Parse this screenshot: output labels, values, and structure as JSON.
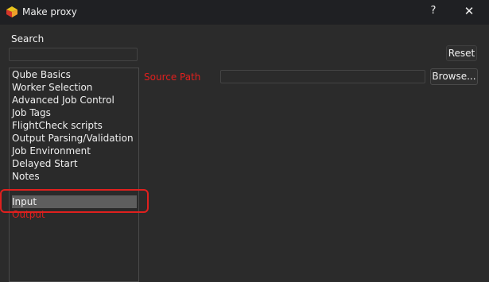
{
  "window": {
    "title": "Make proxy",
    "help_label": "?",
    "close_label": "✕",
    "app_icon": "qube-logo-icon"
  },
  "search": {
    "label": "Search",
    "value": "",
    "placeholder": ""
  },
  "reset_label": "Reset",
  "categories": [
    {
      "label": "Qube Basics"
    },
    {
      "label": "Worker Selection"
    },
    {
      "label": "Advanced Job Control"
    },
    {
      "label": "Job Tags"
    },
    {
      "label": "FlightCheck scripts"
    },
    {
      "label": "Output Parsing/Validation"
    },
    {
      "label": "Job Environment"
    },
    {
      "label": "Delayed Start"
    },
    {
      "label": "Notes"
    },
    {
      "label": "Input"
    },
    {
      "label": "Output"
    }
  ],
  "selected_category": "Input",
  "form": {
    "source_path_label": "Source Path",
    "source_path_value": "",
    "browse_label": "Browse..."
  },
  "colors": {
    "error": "#e0201e",
    "background": "#2b2b2b",
    "titlebar": "#1f2023",
    "selection": "#5e5e5e"
  }
}
